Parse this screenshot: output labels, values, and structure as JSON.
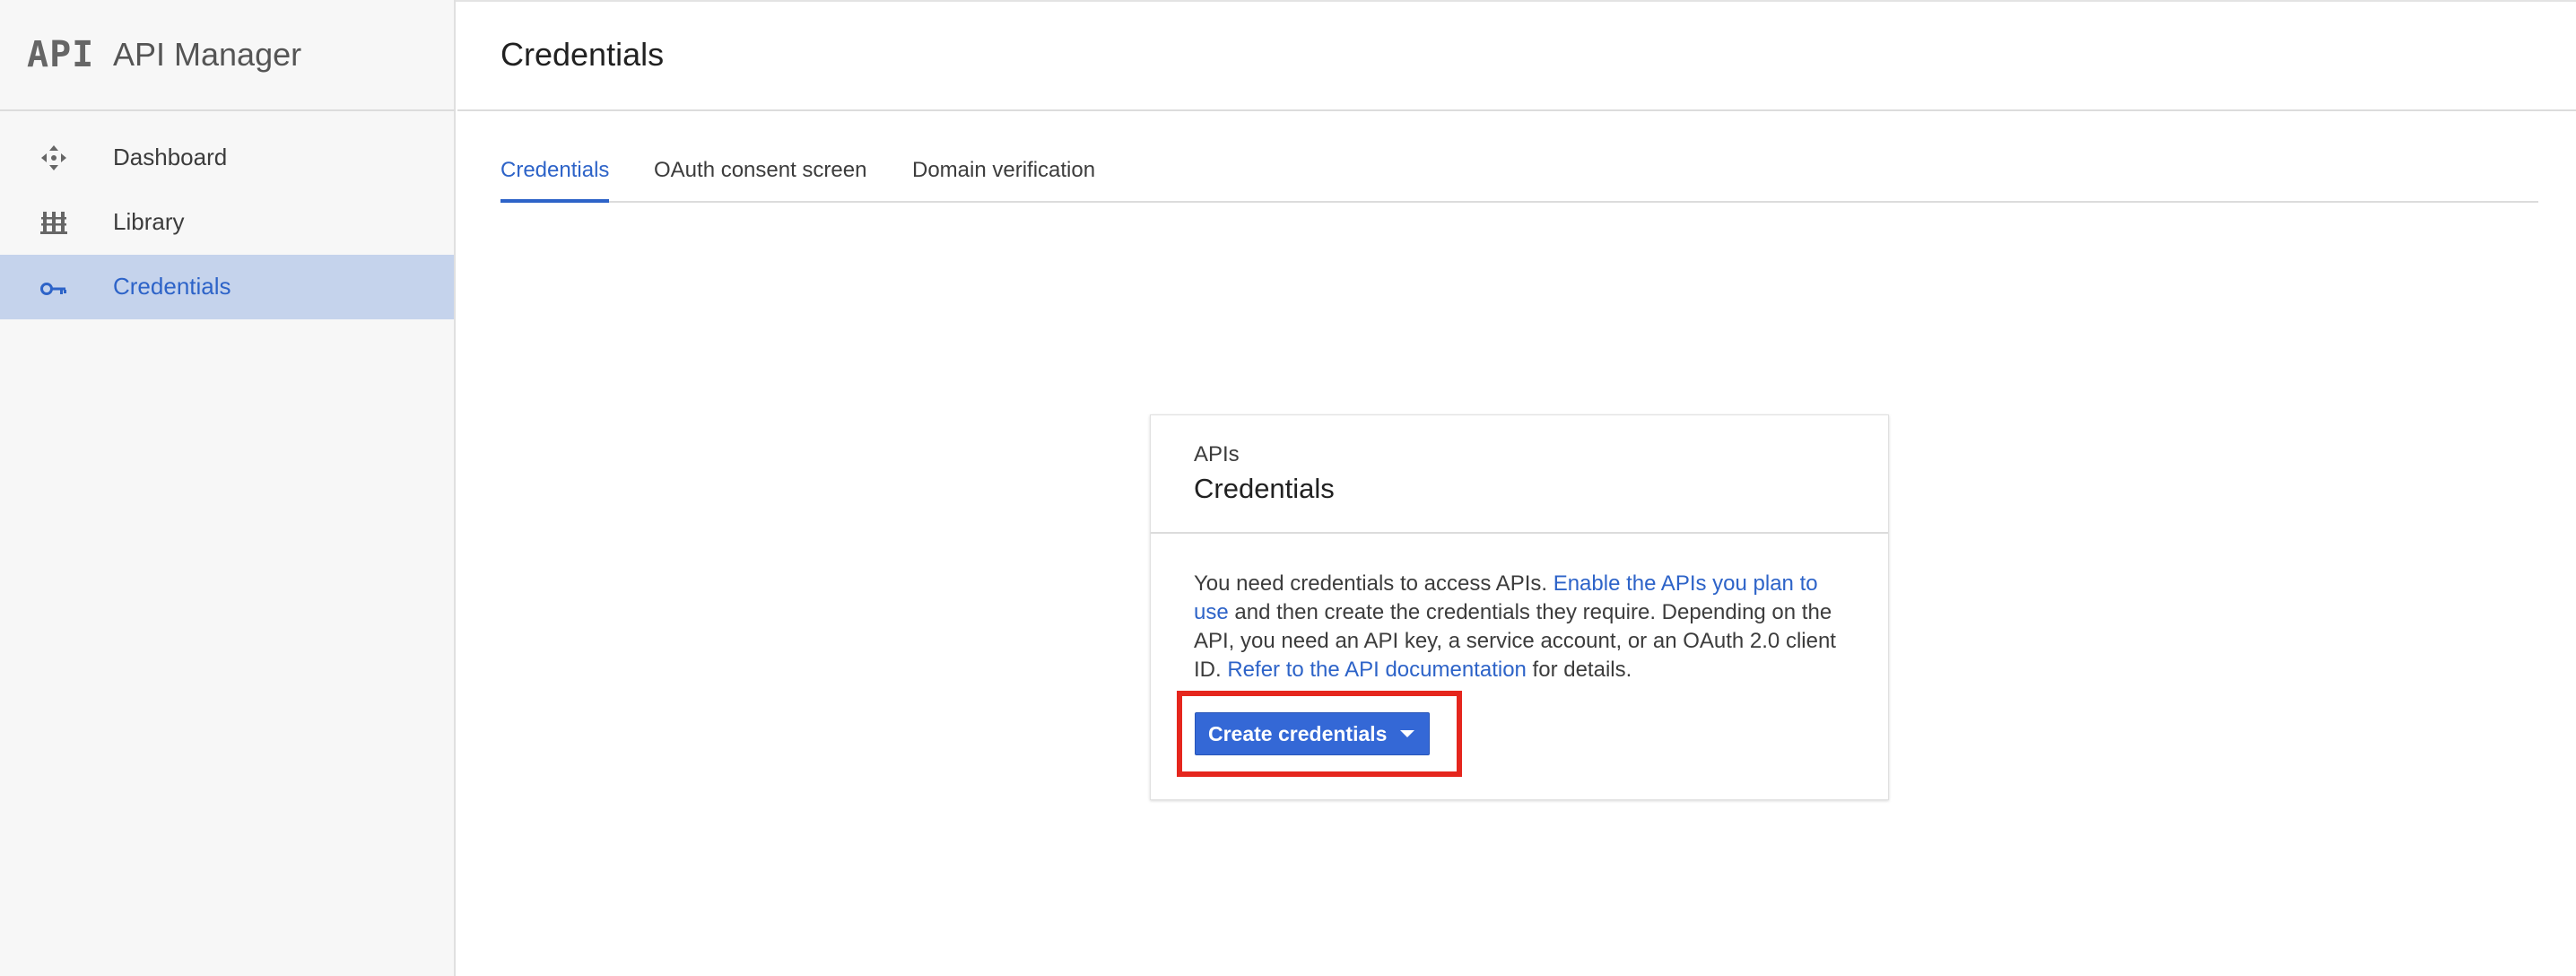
{
  "app": {
    "logo_text": "API",
    "title": "API Manager"
  },
  "sidebar": {
    "items": [
      {
        "label": "Dashboard",
        "icon": "dashboard-icon",
        "active": false
      },
      {
        "label": "Library",
        "icon": "library-icon",
        "active": false
      },
      {
        "label": "Credentials",
        "icon": "key-icon",
        "active": true
      }
    ]
  },
  "header": {
    "title": "Credentials"
  },
  "tabs": [
    {
      "label": "Credentials",
      "active": true
    },
    {
      "label": "OAuth consent screen",
      "active": false
    },
    {
      "label": "Domain verification",
      "active": false
    }
  ],
  "card": {
    "subtitle": "APIs",
    "title": "Credentials",
    "body": {
      "text1": "You need credentials to access APIs. ",
      "link1": "Enable the APIs you plan to use",
      "text2": " and then create the credentials they require. Depending on the API, you need an API key, a service account, or an OAuth 2.0 client ID. ",
      "link2": "Refer to the API documentation",
      "text3": " for details."
    },
    "button_label": "Create credentials"
  },
  "colors": {
    "accent": "#3468d6",
    "active_nav_bg": "#c5d3ec",
    "highlight": "#e5261d",
    "link": "#2d63c8"
  }
}
